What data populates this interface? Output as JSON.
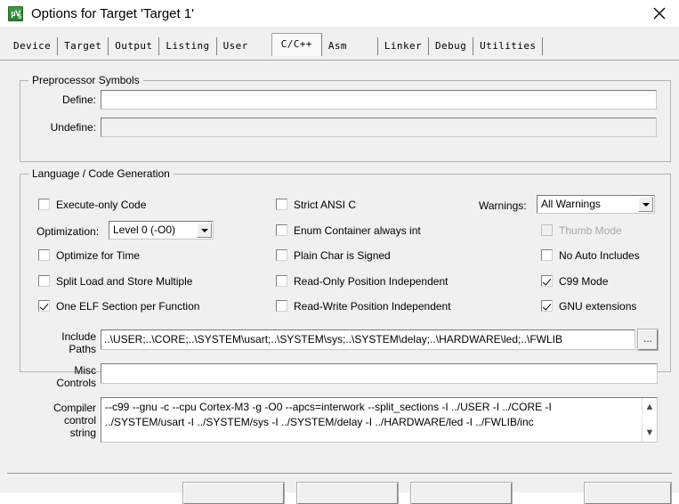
{
  "window": {
    "title": "Options for Target 'Target 1'",
    "icon": "uvision5-icon",
    "close_label": "close-icon"
  },
  "tabs": [
    {
      "label": "Device",
      "active": false
    },
    {
      "label": "Target",
      "active": false
    },
    {
      "label": "Output",
      "active": false
    },
    {
      "label": "Listing",
      "active": false
    },
    {
      "label": "User",
      "active": false
    },
    {
      "label": "C/C++",
      "active": true
    },
    {
      "label": "Asm",
      "active": false
    },
    {
      "label": "Linker",
      "active": false
    },
    {
      "label": "Debug",
      "active": false
    },
    {
      "label": "Utilities",
      "active": false
    }
  ],
  "preprocessor": {
    "title": "Preprocessor Symbols",
    "define_label": "Define:",
    "define_value": "",
    "undefine_label": "Undefine:",
    "undefine_value": ""
  },
  "language": {
    "title": "Language / Code Generation",
    "left_column": [
      {
        "label": "Execute-only Code",
        "checked": false,
        "disabled": false
      },
      {
        "label": "Optimize for Time",
        "checked": false,
        "disabled": false
      },
      {
        "label": "Split Load and Store Multiple",
        "checked": false,
        "disabled": false
      },
      {
        "label": "One ELF Section per Function",
        "checked": true,
        "disabled": false
      }
    ],
    "optimization_label": "Optimization:",
    "optimization_value": "Level 0 (-O0)",
    "middle_column": [
      {
        "label": "Strict ANSI C",
        "checked": false,
        "disabled": false
      },
      {
        "label": "Enum Container always int",
        "checked": false,
        "disabled": false
      },
      {
        "label": "Plain Char is Signed",
        "checked": false,
        "disabled": false
      },
      {
        "label": "Read-Only Position Independent",
        "checked": false,
        "disabled": false
      },
      {
        "label": "Read-Write Position Independent",
        "checked": false,
        "disabled": false
      }
    ],
    "warnings_label": "Warnings:",
    "warnings_value": "All Warnings",
    "right_column": [
      {
        "label": "Thumb Mode",
        "checked": false,
        "disabled": true
      },
      {
        "label": "No Auto Includes",
        "checked": false,
        "disabled": false
      },
      {
        "label": "C99 Mode",
        "checked": true,
        "disabled": false
      },
      {
        "label": "GNU extensions",
        "checked": true,
        "disabled": false
      }
    ]
  },
  "paths": {
    "include_label_line1": "Include",
    "include_label_line2": "Paths",
    "include_value": "..\\USER;..\\CORE;..\\SYSTEM\\usart;..\\SYSTEM\\sys;..\\SYSTEM\\delay;..\\HARDWARE\\led;..\\FWLIB",
    "browse_label": "...",
    "misc_label_line1": "Misc",
    "misc_label_line2": "Controls",
    "misc_value": ""
  },
  "compiler": {
    "label_line1": "Compiler",
    "label_line2": "control",
    "label_line3": "string",
    "line1": "--c99 --gnu -c --cpu Cortex-M3 -g -O0 --apcs=interwork --split_sections -I ../USER -I ../CORE -I",
    "line2": "../SYSTEM/usart -I ../SYSTEM/sys -I ../SYSTEM/delay -I ../HARDWARE/led -I ../FWLIB/inc",
    "scroll_up": "▲",
    "scroll_down": "▼"
  },
  "footer": {
    "buttons": [
      {
        "label": ""
      },
      {
        "label": ""
      },
      {
        "label": ""
      },
      {
        "label": ""
      }
    ]
  },
  "colors": {
    "dialog_bg": "#f0f0f0",
    "titlebar_bg": "#ffffff",
    "field_bg": "#ffffff",
    "group_border": "#b4b4b4",
    "accent_green": "#3f9b47"
  }
}
